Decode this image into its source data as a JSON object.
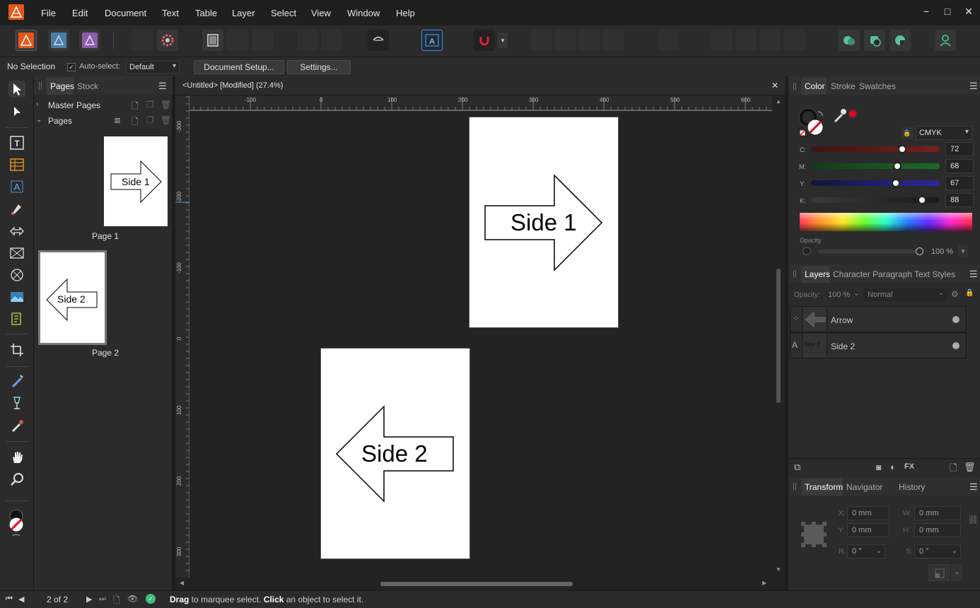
{
  "menu": [
    "File",
    "Edit",
    "Document",
    "Text",
    "Table",
    "Layer",
    "Select",
    "View",
    "Window",
    "Help"
  ],
  "window_controls": [
    "−",
    "□",
    "✕"
  ],
  "context": {
    "selection": "No Selection",
    "auto_select_label": "Auto-select:",
    "auto_select_value": "Default",
    "document_setup": "Document Setup...",
    "settings": "Settings..."
  },
  "pages_panel": {
    "tabs": [
      "Pages",
      "Stock"
    ],
    "master_pages": "Master Pages",
    "pages": "Pages",
    "page1_label": "Page 1",
    "page2_label": "Page 2",
    "page1_thumb_text": "Side 1",
    "page2_thumb_text": "Side 2"
  },
  "document": {
    "title": "<Untitled> [Modified] (27.4%)",
    "ruler_unit": "mm",
    "h_ticks": [
      "-100",
      "0",
      "100",
      "200",
      "300",
      "400",
      "500",
      "600"
    ],
    "v_ticks": [
      "-300",
      "-200",
      "-100",
      "0",
      "100",
      "200",
      "300"
    ],
    "page1_text": "Side 1",
    "page2_text": "Side 2"
  },
  "color_panel": {
    "tabs": [
      "Color",
      "Stroke",
      "Swatches"
    ],
    "model": "CMYK",
    "channels": [
      {
        "label": "C:",
        "value": "72",
        "color": "#7a1e1e"
      },
      {
        "label": "M:",
        "value": "68",
        "color": "#1b6b2a"
      },
      {
        "label": "Y:",
        "value": "67",
        "color": "#2a2a9a"
      },
      {
        "label": "K:",
        "value": "88",
        "color": "#5a5a5a"
      }
    ],
    "opacity_label": "Opacity",
    "opacity_value": "100 %"
  },
  "layers_panel": {
    "tabs": [
      "Layers",
      "Character",
      "Paragraph",
      "Text Styles"
    ],
    "opacity_label": "Opacity:",
    "opacity_value": "100 %",
    "blend": "Normal",
    "layers": [
      {
        "type_icon": "⁘",
        "name": "Arrow"
      },
      {
        "type_icon": "A",
        "name": "Side 2",
        "thumb_text": "Side 2"
      }
    ]
  },
  "transform_panel": {
    "tabs": [
      "Transform",
      "Navigator",
      "History"
    ],
    "x_label": "X:",
    "x_value": "0 mm",
    "y_label": "Y:",
    "y_value": "0 mm",
    "w_label": "W:",
    "w_value": "0 mm",
    "h_label": "H:",
    "h_value": "0 mm",
    "r_label": "R:",
    "r_value": "0 °",
    "s_label": "S:",
    "s_value": "0 °"
  },
  "status": {
    "page_indicator": "2 of 2",
    "hint_b1": "Drag",
    "hint_t1": " to marquee select. ",
    "hint_b2": "Click",
    "hint_t2": " an object to select it."
  },
  "colors": {
    "accent": "#4a90d9",
    "app_orange": "#e8561a",
    "selected_red": "#e6001b"
  }
}
